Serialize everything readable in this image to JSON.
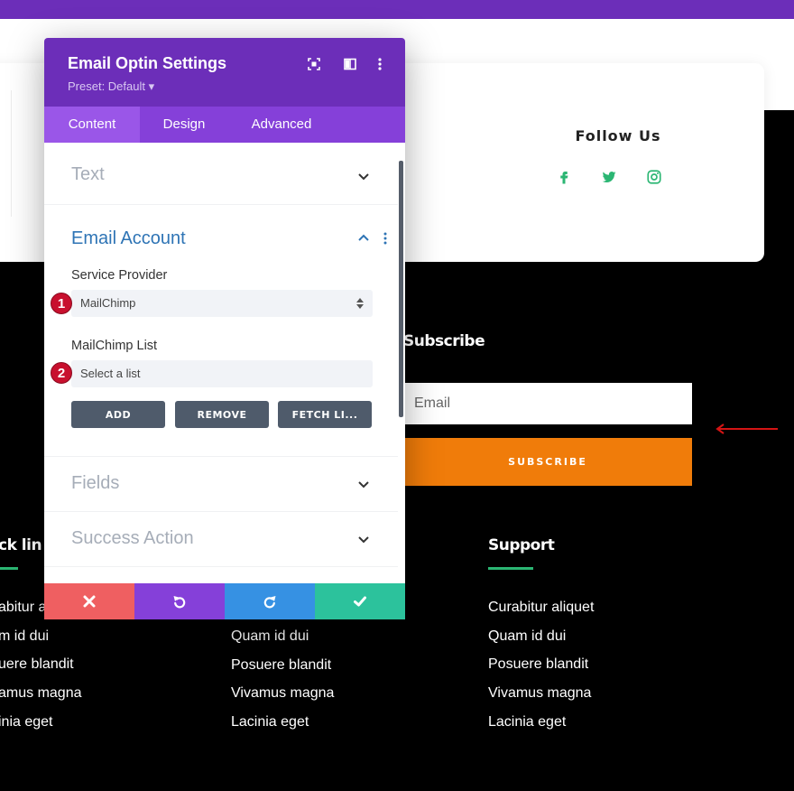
{
  "colors": {
    "purple": "#6c2eb9",
    "tab_bar": "#8540d9",
    "orange": "#f07c0a",
    "green": "#2bb673",
    "badge_red": "#c8102e",
    "cancel": "#ef5f61",
    "undo": "#8540d9",
    "redo": "#3691e3",
    "save": "#2cc29c"
  },
  "page": {
    "follow": {
      "title": "Follow Us",
      "icons": [
        "facebook-icon",
        "twitter-icon",
        "instagram-icon"
      ]
    },
    "subscribe": {
      "title": "Subscribe",
      "email_placeholder": "Email",
      "button_label": "SUBSCRIBE"
    },
    "columns": [
      {
        "title": "ck lin",
        "items": [
          "abitur a",
          "m id dui",
          "uere blandit",
          "amus magna",
          "inia eget"
        ]
      },
      {
        "title": "",
        "items": [
          "Quam id dui",
          "Posuere blandit",
          "Vivamus magna",
          "Lacinia eget"
        ]
      },
      {
        "title": "Support",
        "items": [
          "Curabitur aliquet",
          "Quam id dui",
          "Posuere blandit",
          "Vivamus magna",
          "Lacinia eget"
        ]
      }
    ]
  },
  "modal": {
    "title": "Email Optin Settings",
    "preset": "Preset: Default ▾",
    "header_icons": [
      "fullscreen-icon",
      "columns-icon",
      "more-vertical-icon"
    ],
    "tabs": [
      {
        "label": "Content",
        "active": true
      },
      {
        "label": "Design",
        "active": false
      },
      {
        "label": "Advanced",
        "active": false
      }
    ],
    "sections": {
      "text": "Text",
      "email_account": "Email Account",
      "fields": "Fields",
      "success_action": "Success Action"
    },
    "service_provider": {
      "label": "Service Provider",
      "value": "MailChimp",
      "badge": "1"
    },
    "list": {
      "label": "MailChimp List",
      "value": "Select a list",
      "badge": "2"
    },
    "buttons": {
      "add": "ADD",
      "remove": "REMOVE",
      "fetch": "FETCH LI..."
    },
    "footer_icons": [
      "close-icon",
      "undo-icon",
      "redo-icon",
      "check-icon"
    ]
  }
}
